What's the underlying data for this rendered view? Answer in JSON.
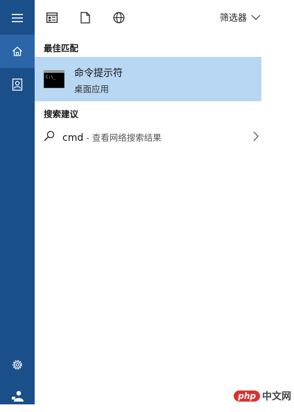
{
  "topbar": {
    "filter_label": "筛选器"
  },
  "sections": {
    "best_match_title": "最佳匹配",
    "suggestions_title": "搜索建议"
  },
  "best_match": {
    "name": "命令提示符",
    "type": "桌面应用"
  },
  "suggestion": {
    "query": "cmd",
    "separator": " - ",
    "action": "查看网络搜索结果"
  },
  "watermark": {
    "brand": "php",
    "site": "中文网"
  },
  "colors": {
    "sidebar": "#1b4f8a",
    "sidebar_active": "#2a66a8",
    "highlight": "#b8d7f2"
  },
  "icons": {
    "sidebar": [
      "hamburger-icon",
      "home-icon",
      "contact-icon",
      "settings-icon",
      "user-icon"
    ],
    "topbar": [
      "apps-icon",
      "documents-icon",
      "web-icon",
      "chevron-down-icon"
    ]
  }
}
